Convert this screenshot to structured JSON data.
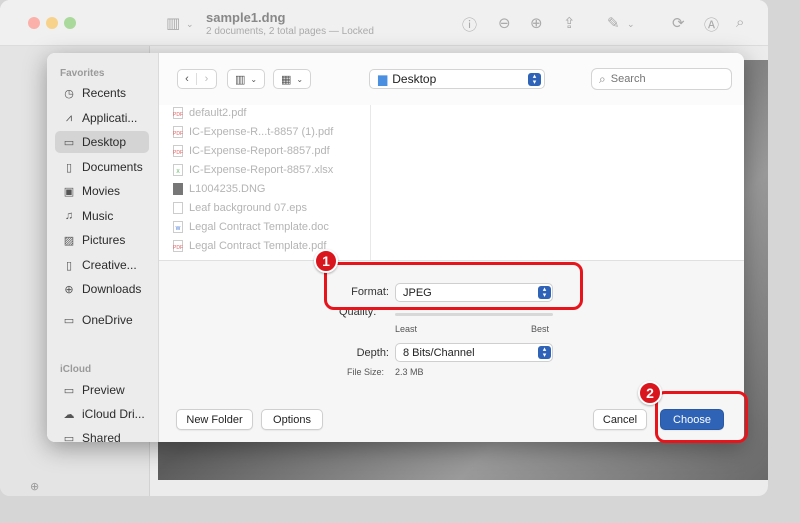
{
  "preview": {
    "title": "sample1.dng",
    "subtitle": "2 documents, 2 total pages — Locked"
  },
  "sidebar": {
    "favorites_label": "Favorites",
    "favorites": [
      {
        "label": "Recents",
        "icon": "clock-icon"
      },
      {
        "label": "Applicati...",
        "icon": "applications-icon"
      },
      {
        "label": "Desktop",
        "icon": "desktop-icon",
        "selected": true
      },
      {
        "label": "Documents",
        "icon": "document-icon"
      },
      {
        "label": "Movies",
        "icon": "film-icon"
      },
      {
        "label": "Music",
        "icon": "music-note-icon"
      },
      {
        "label": "Pictures",
        "icon": "picture-icon"
      },
      {
        "label": "Creative...",
        "icon": "document-icon"
      },
      {
        "label": "Downloads",
        "icon": "download-icon"
      },
      {
        "label": "OneDrive",
        "icon": "folder-icon"
      }
    ],
    "icloud_label": "iCloud",
    "icloud": [
      {
        "label": "Preview",
        "icon": "folder-icon"
      },
      {
        "label": "iCloud Dri...",
        "icon": "cloud-icon"
      },
      {
        "label": "Shared",
        "icon": "shared-folder-icon"
      }
    ]
  },
  "toolbar": {
    "location": "Desktop",
    "search_placeholder": "Search"
  },
  "files": [
    {
      "name": "default2.pdf",
      "icon": "pdf-icon"
    },
    {
      "name": "IC-Expense-R...t-8857 (1).pdf",
      "icon": "pdf-icon"
    },
    {
      "name": "IC-Expense-Report-8857.pdf",
      "icon": "pdf-icon"
    },
    {
      "name": "IC-Expense-Report-8857.xlsx",
      "icon": "spreadsheet-icon"
    },
    {
      "name": "L1004235.DNG",
      "icon": "image-icon"
    },
    {
      "name": "Leaf background 07.eps",
      "icon": "document-icon"
    },
    {
      "name": "Legal Contract Template.doc",
      "icon": "word-icon"
    },
    {
      "name": "Legal Contract Template.pdf",
      "icon": "pdf-icon"
    }
  ],
  "options": {
    "format_label": "Format:",
    "format_value": "JPEG",
    "quality_label": "Quality:",
    "quality_least": "Least",
    "quality_best": "Best",
    "depth_label": "Depth:",
    "depth_value": "8 Bits/Channel",
    "filesize_label": "File Size:",
    "filesize_value": "2.3 MB"
  },
  "buttons": {
    "new_folder": "New Folder",
    "options": "Options",
    "cancel": "Cancel",
    "choose": "Choose"
  },
  "annotations": {
    "badge1": "1",
    "badge2": "2",
    "color": "#e8141c"
  }
}
